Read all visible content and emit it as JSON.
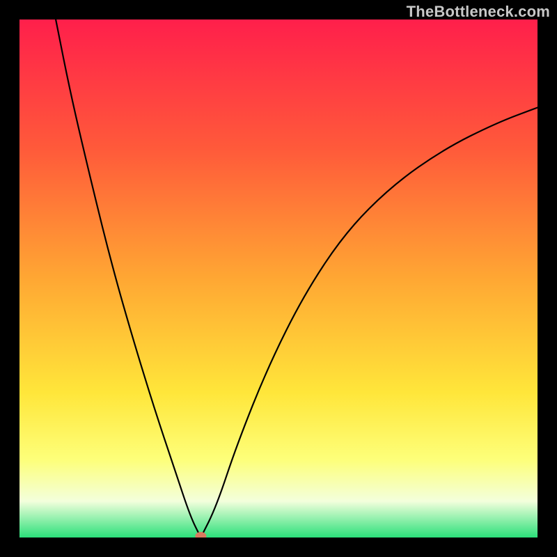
{
  "watermark": "TheBottleneck.com",
  "chart_data": {
    "type": "line",
    "title": "",
    "xlabel": "",
    "ylabel": "",
    "xlim": [
      0,
      100
    ],
    "ylim": [
      0,
      100
    ],
    "grid": false,
    "axes_visible": false,
    "background": {
      "type": "vertical-gradient",
      "stops": [
        {
          "offset": 0,
          "color": "#ff1f4b"
        },
        {
          "offset": 25,
          "color": "#ff5a3a"
        },
        {
          "offset": 50,
          "color": "#ffa733"
        },
        {
          "offset": 72,
          "color": "#ffe63a"
        },
        {
          "offset": 85,
          "color": "#fdff7a"
        },
        {
          "offset": 93,
          "color": "#f3ffdc"
        },
        {
          "offset": 100,
          "color": "#2be07a"
        }
      ]
    },
    "marker": {
      "x": 35,
      "y": 0,
      "color": "#d97a60",
      "radius": 1.0
    },
    "series": [
      {
        "name": "left-branch",
        "x": [
          7,
          10,
          14,
          18,
          22,
          26,
          30,
          33,
          35
        ],
        "y": [
          100,
          85,
          68,
          52,
          38,
          25,
          13,
          4,
          0
        ]
      },
      {
        "name": "right-branch",
        "x": [
          35,
          38,
          42,
          48,
          55,
          63,
          72,
          82,
          92,
          100
        ],
        "y": [
          0,
          6,
          18,
          33,
          47,
          59,
          68,
          75,
          80,
          83
        ]
      }
    ]
  }
}
